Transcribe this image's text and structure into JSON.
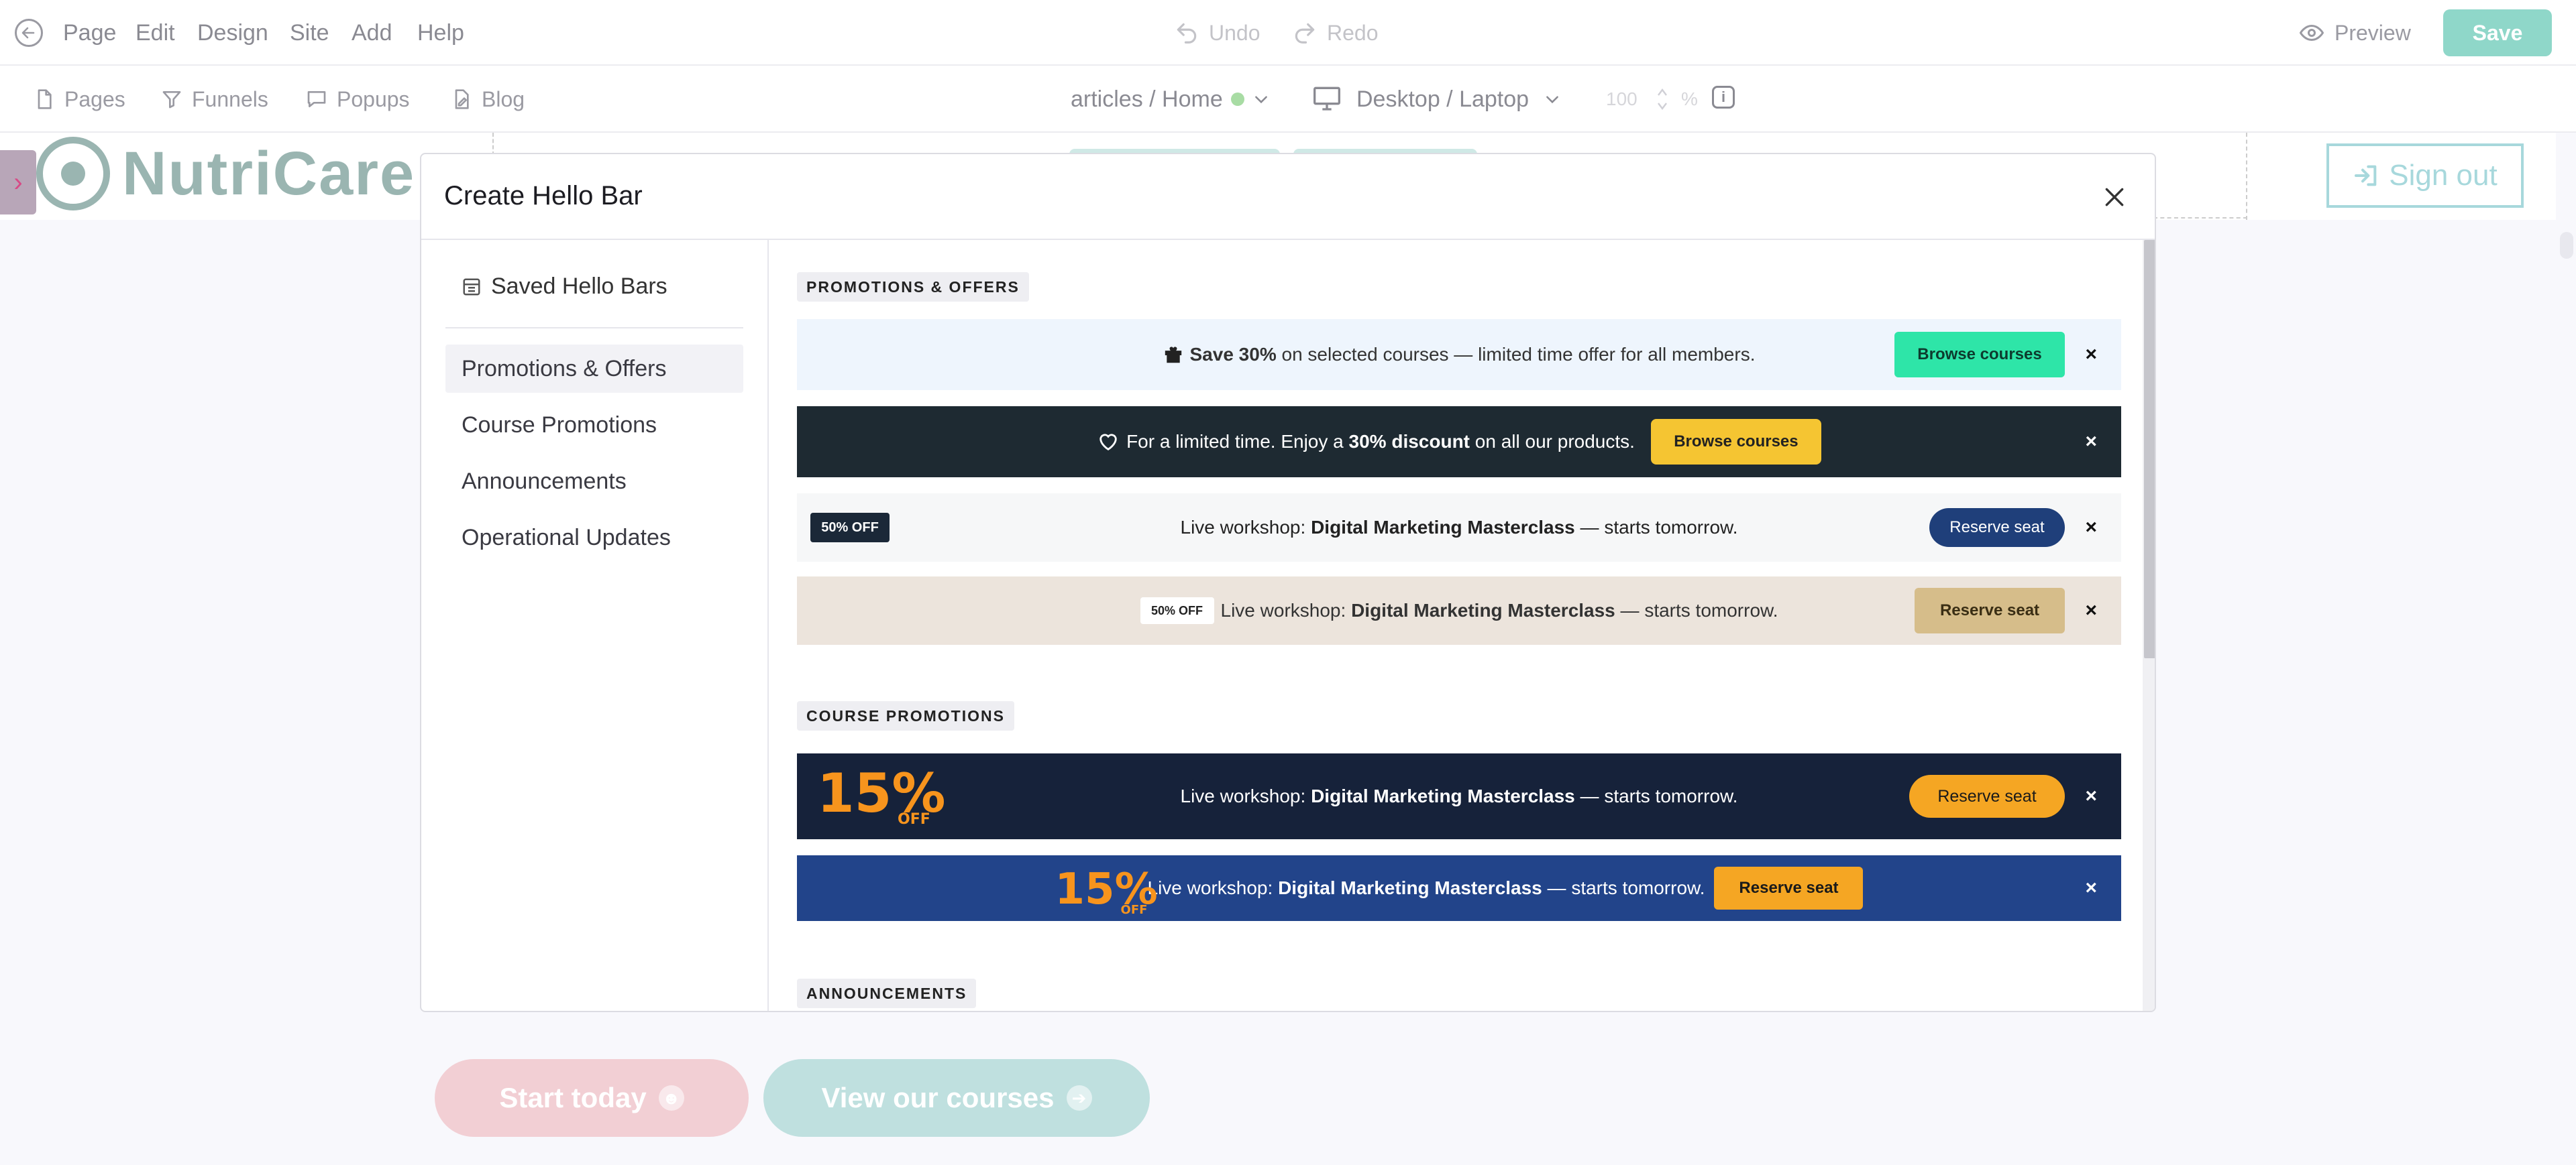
{
  "topbar": {
    "menu": [
      "Page",
      "Edit",
      "Design",
      "Site",
      "Add",
      "Help"
    ],
    "undo": "Undo",
    "redo": "Redo",
    "preview": "Preview",
    "save": "Save"
  },
  "toolbar": {
    "pages": "Pages",
    "funnels": "Funnels",
    "popups": "Popups",
    "blog": "Blog",
    "breadcrumb": "articles / Home",
    "device": "Desktop / Laptop",
    "zoom_value": "100",
    "zoom_unit": "%",
    "info_icon": "i"
  },
  "canvas": {
    "logo_text": "NutriCare",
    "sign_out": "Sign out",
    "cta_start": "Start today",
    "cta_courses": "View our courses",
    "colors": {
      "start": "#f2cfd4",
      "courses": "#bfe0df"
    }
  },
  "modal": {
    "title": "Create Hello Bar",
    "saved": "Saved Hello Bars",
    "nav": [
      "Promotions & Offers",
      "Course Promotions",
      "Announcements",
      "Operational Updates"
    ],
    "sections": {
      "promotions": "PROMOTIONS & OFFERS",
      "course": "COURSE PROMOTIONS",
      "announcements": "ANNOUNCEMENTS"
    },
    "bars": {
      "b1": {
        "bold": "Save 30%",
        "rest": " on selected courses — limited time offer for all members.",
        "button": "Browse courses",
        "close": "×"
      },
      "b2": {
        "pre": "For a limited time. Enjoy a ",
        "bold": "30% discount",
        "post": " on all our products.",
        "button": "Browse courses",
        "close": "×"
      },
      "b3": {
        "badge": "50% OFF",
        "pre": "Live workshop: ",
        "bold": "Digital Marketing Masterclass",
        "post": " — starts tomorrow.",
        "button": "Reserve seat",
        "close": "×"
      },
      "b4": {
        "badge": "50% OFF",
        "pre": "Live workshop: ",
        "bold": "Digital Marketing Masterclass",
        "post": " — starts tomorrow.",
        "button": "Reserve seat",
        "close": "×"
      },
      "b5": {
        "pct": "15%",
        "off": "OFF",
        "pre": "Live workshop: ",
        "bold": "Digital Marketing Masterclass",
        "post": " — starts tomorrow.",
        "button": "Reserve seat",
        "close": "×"
      },
      "b6": {
        "pct": "15%",
        "off": "OFF",
        "pre": "Live workshop: ",
        "bold": "Digital Marketing Masterclass",
        "post": " — starts tomorrow.",
        "button": "Reserve seat",
        "close": "×"
      }
    }
  }
}
